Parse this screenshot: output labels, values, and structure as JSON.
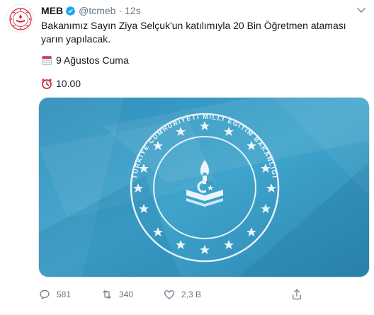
{
  "tweet": {
    "author_name": "MEB",
    "handle": "@tcmeb",
    "separator": "·",
    "time": "12s",
    "text": "Bakanımız Sayın Ziya Selçuk'un katılımıyla 20 Bin Öğretmen ataması yarın yapılacak.",
    "date_line": "9 Ağustos Cuma",
    "time_line": "10.00",
    "date_icon": "calendar-icon",
    "time_icon": "alarm-clock-icon",
    "media": {
      "seal_text": "TÜRKİYE CUMHURİYETİ MİLLİ EĞİTİM BAKANLIĞI"
    }
  },
  "actions": {
    "reply_count": "581",
    "retweet_count": "340",
    "like_count": "2,3 B"
  },
  "colors": {
    "text": "#14171a",
    "muted": "#657786",
    "verified": "#1da1f2",
    "media_bg": "#3a9ec5",
    "logo_red": "#d0202e"
  }
}
